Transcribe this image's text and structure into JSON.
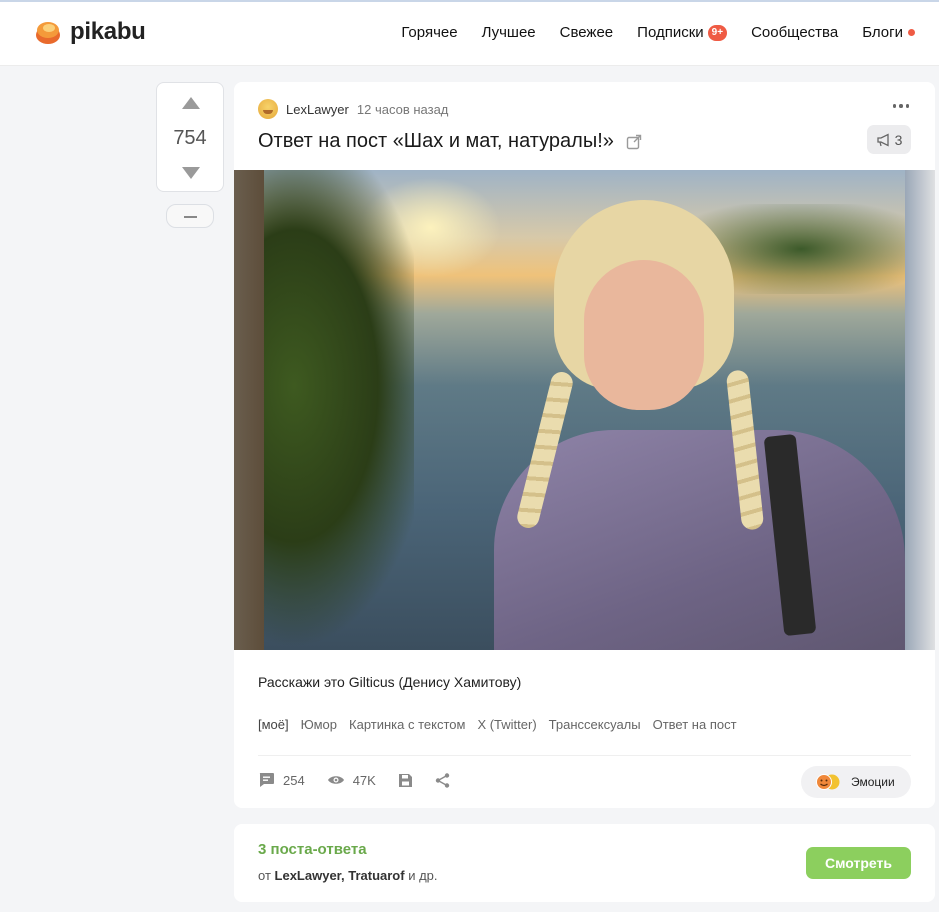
{
  "header": {
    "logo_text": "pikabu",
    "nav": [
      {
        "label": "Горячее"
      },
      {
        "label": "Лучшее"
      },
      {
        "label": "Свежее"
      },
      {
        "label": "Подписки",
        "badge": "9+"
      },
      {
        "label": "Сообщества"
      },
      {
        "label": "Блоги",
        "has_dot": true
      }
    ],
    "accent_color": "#ef5b44"
  },
  "vote": {
    "rating": "754",
    "up_icon": "triangle-up-icon",
    "down_icon": "triangle-down-icon",
    "minus_icon": "minus-icon"
  },
  "post": {
    "author": "LexLawyer",
    "time": "12 часов назад",
    "title": "Ответ на пост «Шах и мат, натуралы!»",
    "reposts": "3",
    "caption": "Расскажи это Gilticus (Денису Хамитову)",
    "tags": [
      "[моё]",
      "Юмор",
      "Картинка с текстом",
      "X (Twitter)",
      "Транссексуалы",
      "Ответ на пост"
    ],
    "comments": "254",
    "views": "47K",
    "emotions_label": "Эмоции"
  },
  "replies": {
    "title": "3 поста-ответа",
    "prefix": "от",
    "authors": "LexLawyer, Tratuarof",
    "suffix": "и др.",
    "button": "Смотреть",
    "accent_color": "#8ccf5e"
  }
}
